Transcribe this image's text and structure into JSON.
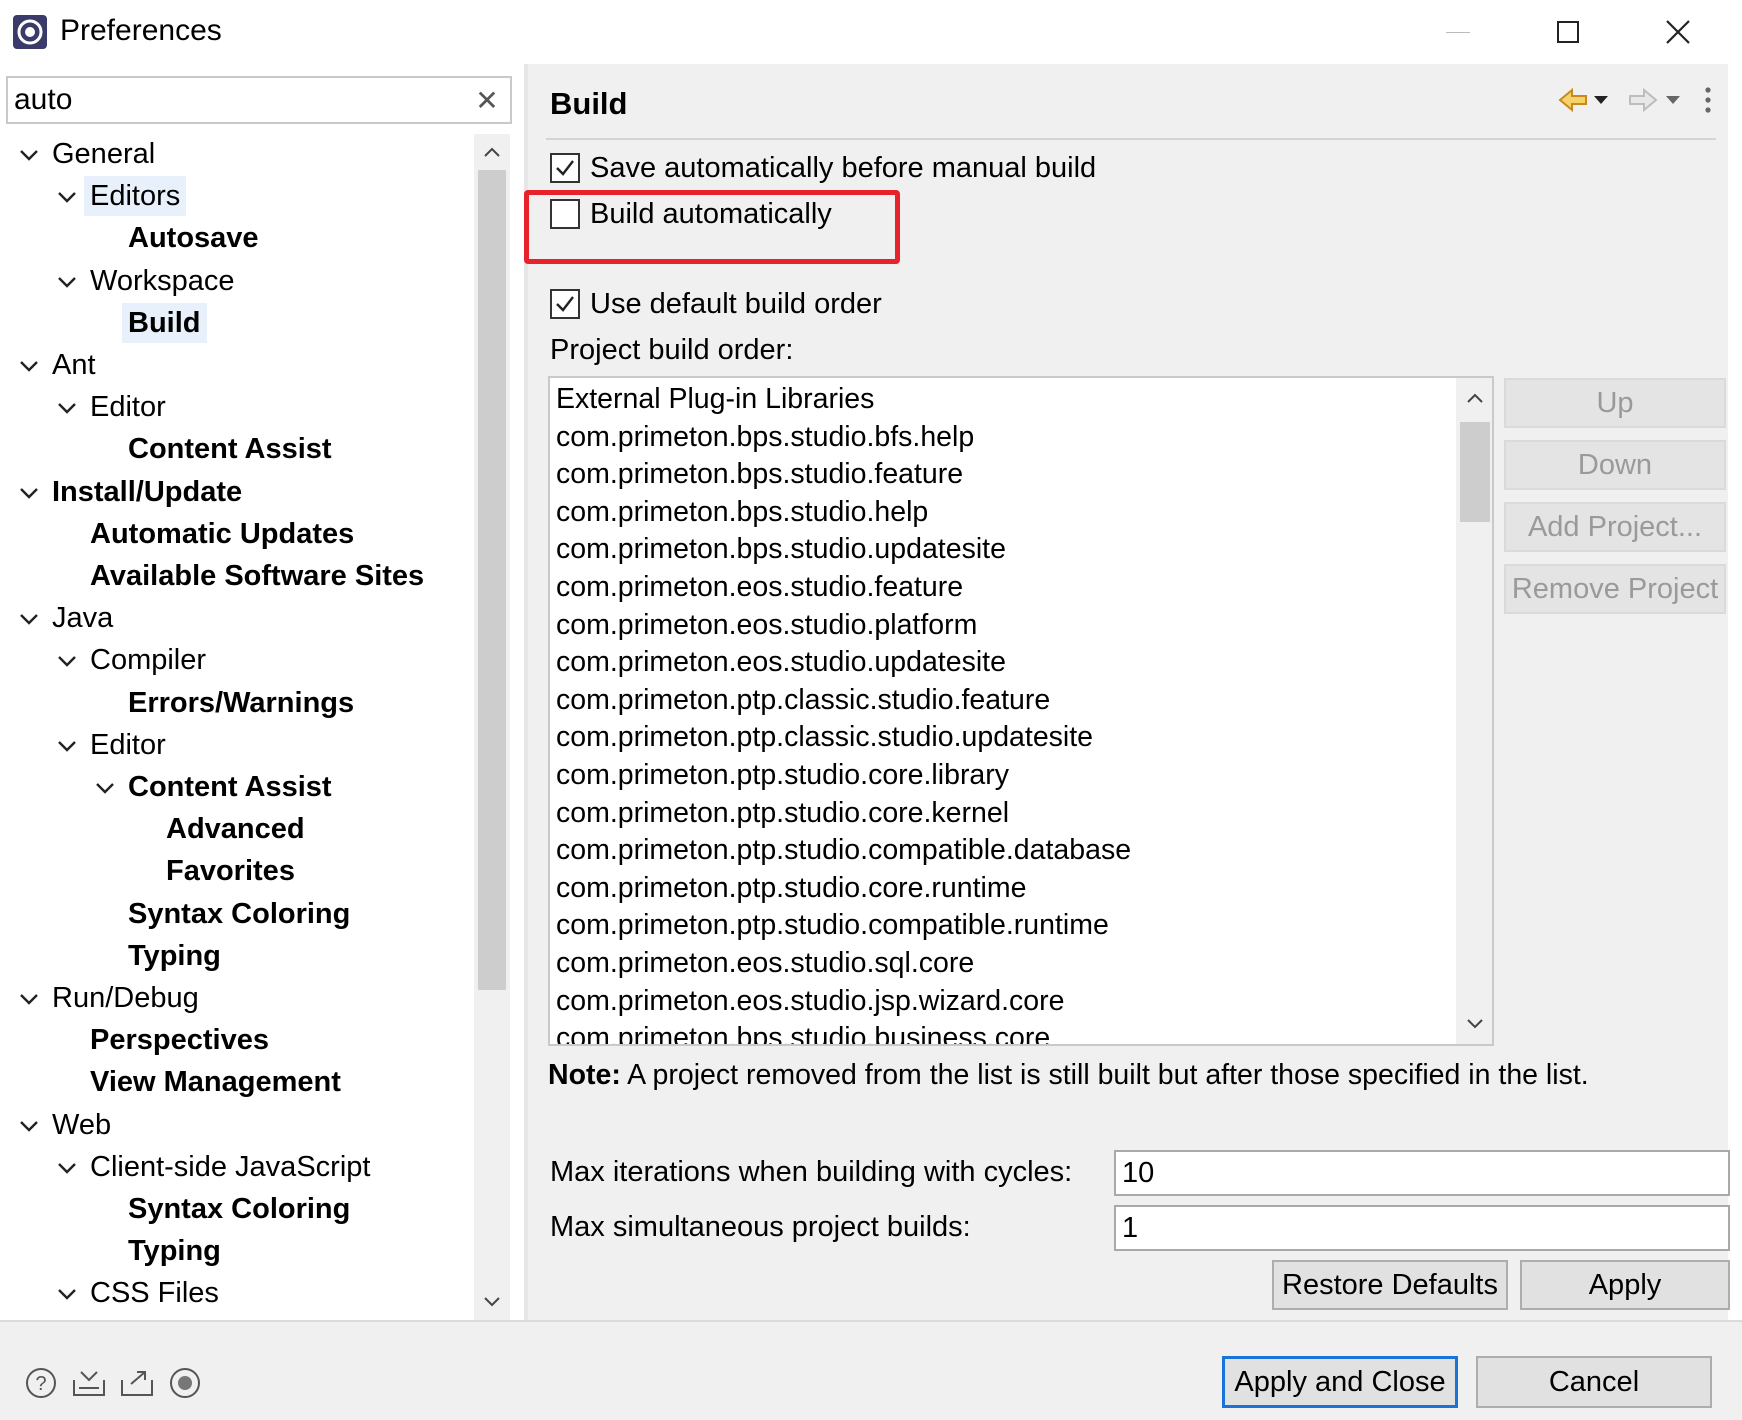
{
  "window": {
    "title": "Preferences"
  },
  "filter": {
    "value": "auto"
  },
  "tree": [
    {
      "label": "General",
      "level": 0,
      "expanded": true,
      "bold": false,
      "selected": false
    },
    {
      "label": "Editors",
      "level": 1,
      "expanded": true,
      "bold": false,
      "selected": true
    },
    {
      "label": "Autosave",
      "level": 2,
      "expanded": null,
      "bold": true,
      "selected": false
    },
    {
      "label": "Workspace",
      "level": 1,
      "expanded": true,
      "bold": false,
      "selected": false
    },
    {
      "label": "Build",
      "level": 2,
      "expanded": null,
      "bold": true,
      "selected": true
    },
    {
      "label": "Ant",
      "level": 0,
      "expanded": true,
      "bold": false,
      "selected": false
    },
    {
      "label": "Editor",
      "level": 1,
      "expanded": true,
      "bold": false,
      "selected": false
    },
    {
      "label": "Content Assist",
      "level": 2,
      "expanded": null,
      "bold": true,
      "selected": false
    },
    {
      "label": "Install/Update",
      "level": 0,
      "expanded": true,
      "bold": true,
      "selected": false
    },
    {
      "label": "Automatic Updates",
      "level": 1,
      "expanded": null,
      "bold": true,
      "selected": false
    },
    {
      "label": "Available Software Sites",
      "level": 1,
      "expanded": null,
      "bold": true,
      "selected": false
    },
    {
      "label": "Java",
      "level": 0,
      "expanded": true,
      "bold": false,
      "selected": false
    },
    {
      "label": "Compiler",
      "level": 1,
      "expanded": true,
      "bold": false,
      "selected": false
    },
    {
      "label": "Errors/Warnings",
      "level": 2,
      "expanded": null,
      "bold": true,
      "selected": false
    },
    {
      "label": "Editor",
      "level": 1,
      "expanded": true,
      "bold": false,
      "selected": false
    },
    {
      "label": "Content Assist",
      "level": 2,
      "expanded": true,
      "bold": true,
      "selected": false
    },
    {
      "label": "Advanced",
      "level": 3,
      "expanded": null,
      "bold": true,
      "selected": false
    },
    {
      "label": "Favorites",
      "level": 3,
      "expanded": null,
      "bold": true,
      "selected": false
    },
    {
      "label": "Syntax Coloring",
      "level": 2,
      "expanded": null,
      "bold": true,
      "selected": false
    },
    {
      "label": "Typing",
      "level": 2,
      "expanded": null,
      "bold": true,
      "selected": false
    },
    {
      "label": "Run/Debug",
      "level": 0,
      "expanded": true,
      "bold": false,
      "selected": false
    },
    {
      "label": "Perspectives",
      "level": 1,
      "expanded": null,
      "bold": true,
      "selected": false
    },
    {
      "label": "View Management",
      "level": 1,
      "expanded": null,
      "bold": true,
      "selected": false
    },
    {
      "label": "Web",
      "level": 0,
      "expanded": true,
      "bold": false,
      "selected": false
    },
    {
      "label": "Client-side JavaScript",
      "level": 1,
      "expanded": true,
      "bold": false,
      "selected": false
    },
    {
      "label": "Syntax Coloring",
      "level": 2,
      "expanded": null,
      "bold": true,
      "selected": false
    },
    {
      "label": "Typing",
      "level": 2,
      "expanded": null,
      "bold": true,
      "selected": false
    },
    {
      "label": "CSS Files",
      "level": 1,
      "expanded": true,
      "bold": false,
      "selected": false
    }
  ],
  "page": {
    "title": "Build",
    "save_auto": {
      "label": "Save automatically before manual build",
      "checked": true
    },
    "build_auto": {
      "label": "Build automatically",
      "checked": false
    },
    "default_order": {
      "label": "Use default build order",
      "checked": true
    },
    "order_label": "Project build order:",
    "projects": [
      "External Plug-in Libraries",
      "com.primeton.bps.studio.bfs.help",
      "com.primeton.bps.studio.feature",
      "com.primeton.bps.studio.help",
      "com.primeton.bps.studio.updatesite",
      "com.primeton.eos.studio.feature",
      "com.primeton.eos.studio.platform",
      "com.primeton.eos.studio.updatesite",
      "com.primeton.ptp.classic.studio.feature",
      "com.primeton.ptp.classic.studio.updatesite",
      "com.primeton.ptp.studio.core.library",
      "com.primeton.ptp.studio.core.kernel",
      "com.primeton.ptp.studio.compatible.database",
      "com.primeton.ptp.studio.core.runtime",
      "com.primeton.ptp.studio.compatible.runtime",
      "com.primeton.eos.studio.sql.core",
      "com.primeton.eos.studio.jsp.wizard.core",
      "com.primeton.bps.studio.business.core"
    ],
    "side_buttons": [
      "Up",
      "Down",
      "Add Project...",
      "Remove Project"
    ],
    "note_bold": "Note:",
    "note_text": " A project removed from the list is still built but after those specified in the list.",
    "max_iter_label": "Max iterations when building with cycles:",
    "max_iter_value": "10",
    "max_sim_label": "Max simultaneous project builds:",
    "max_sim_value": "1",
    "restore_label": "Restore Defaults",
    "apply_label": "Apply"
  },
  "footer": {
    "apply_close_label": "Apply and Close",
    "cancel_label": "Cancel"
  },
  "colors": {
    "highlight": "#e8222a",
    "selection": "#e8f1fb",
    "accent": "#1a73d9"
  }
}
